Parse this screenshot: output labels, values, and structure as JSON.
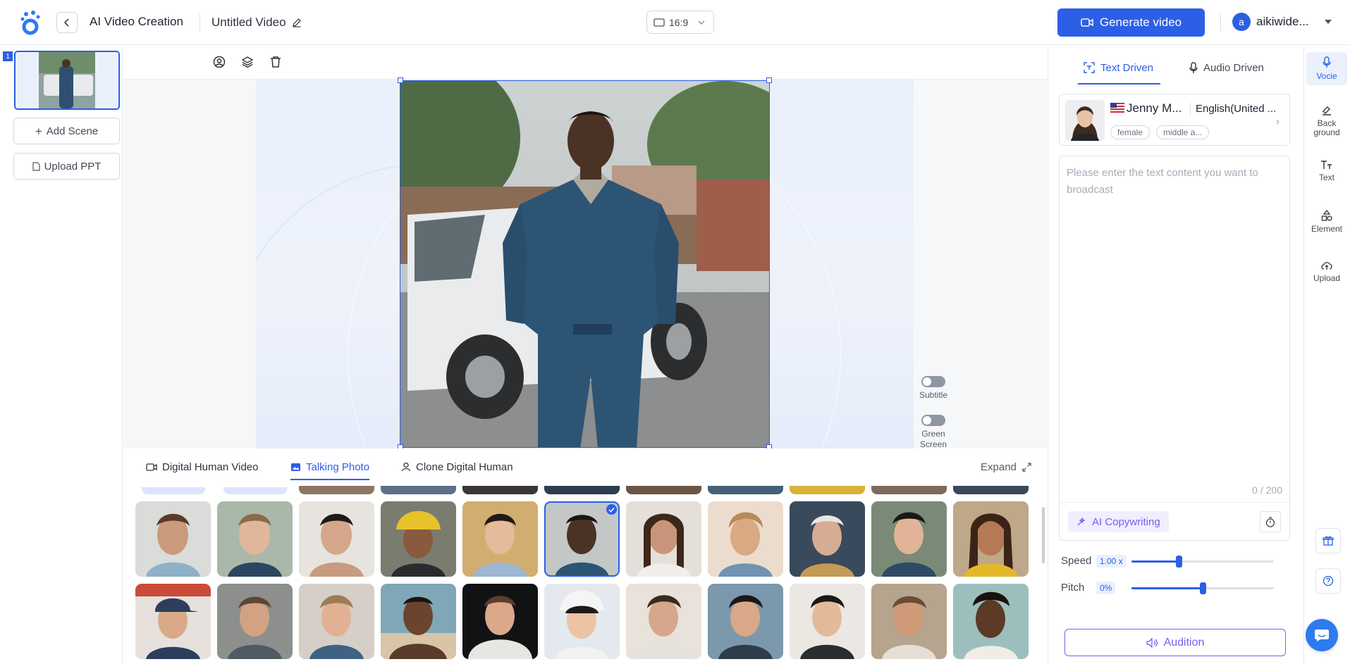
{
  "app": {
    "title": "AI Video Creation",
    "video_title": "Untitled Video",
    "aspect_ratio": "16:9",
    "generate_label": "Generate video",
    "user_initial": "a",
    "username": "aikiwide..."
  },
  "scenes": {
    "items": [
      {
        "number": "1"
      }
    ],
    "add_scene_label": "Add Scene",
    "upload_ppt_label": "Upload PPT"
  },
  "canvas": {
    "toolbar_icons": [
      "avatar-icon",
      "layers-icon",
      "trash-icon"
    ],
    "subtitle_label": "Subtitle",
    "subtitle_on": false,
    "green_screen_label": "Green Screen",
    "green_screen_on": false
  },
  "library": {
    "tabs": [
      {
        "label": "Digital Human Video",
        "icon": "video-camera-icon",
        "active": false
      },
      {
        "label": "Talking Photo",
        "icon": "image-icon",
        "active": true
      },
      {
        "label": "Clone Digital Human",
        "icon": "person-icon",
        "active": false
      }
    ],
    "expand_label": "Expand",
    "selected_index": 5
  },
  "voice_panel": {
    "tabs": [
      {
        "label": "Text Driven",
        "icon": "text-scan-icon",
        "active": true
      },
      {
        "label": "Audio Driven",
        "icon": "microphone-icon",
        "active": false
      }
    ],
    "voice": {
      "name": "Jenny M...",
      "language": "English(United ...",
      "tags": [
        "female",
        "middle a..."
      ],
      "flag": "us-flag-icon"
    },
    "text_placeholder": "Please enter the text content you want to broadcast",
    "char_count": "0 / 200",
    "ai_copywriting_label": "AI Copywriting",
    "speed": {
      "label": "Speed",
      "value_text": "1.00 x",
      "value": 0.33
    },
    "pitch": {
      "label": "Pitch",
      "value_text": "0%",
      "value": 0.5
    },
    "audition_label": "Audition"
  },
  "rail": {
    "items": [
      {
        "label": "Vocie",
        "icon": "microphone-icon",
        "active": true
      },
      {
        "label": "Back ground",
        "icon": "background-icon",
        "active": false
      },
      {
        "label": "Text",
        "icon": "text-icon",
        "active": false
      },
      {
        "label": "Element",
        "icon": "shapes-icon",
        "active": false
      },
      {
        "label": "Upload",
        "icon": "upload-cloud-icon",
        "active": false
      }
    ]
  },
  "colors": {
    "accent": "#2c5fe6",
    "purple": "#7a5cf0"
  }
}
